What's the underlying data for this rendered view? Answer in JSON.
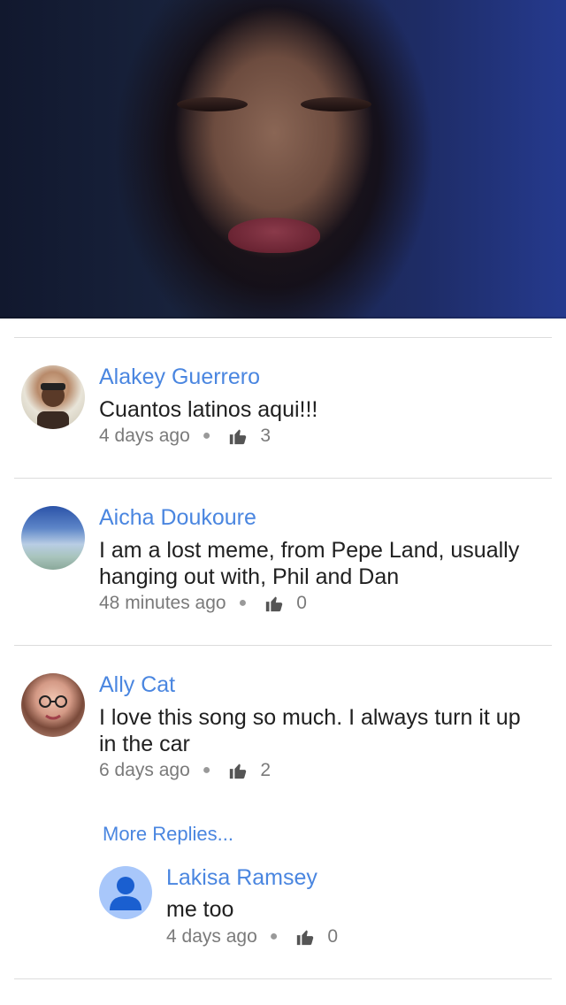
{
  "video": {
    "icon": "video-frame"
  },
  "comments": [
    {
      "name": "Alakey Guerrero",
      "text": "Cuantos latinos aqui!!!",
      "time": "4 days ago",
      "likes": "3"
    },
    {
      "name": "Aicha Doukoure",
      "text": "I am a lost meme, from Pepe Land, usually hanging out with, Phil and Dan",
      "time": "48 minutes ago",
      "likes": "0"
    },
    {
      "name": "Ally Cat",
      "text": "I love this song so much. I always turn it up in the car",
      "time": "6 days ago",
      "likes": "2"
    }
  ],
  "more_replies": "More Replies...",
  "reply": {
    "name": "Lakisa Ramsey",
    "text": "me too",
    "time": "4 days ago",
    "likes": "0"
  },
  "colors": {
    "link": "#4a86e0",
    "text": "#202020",
    "meta": "#7a7a7a"
  }
}
